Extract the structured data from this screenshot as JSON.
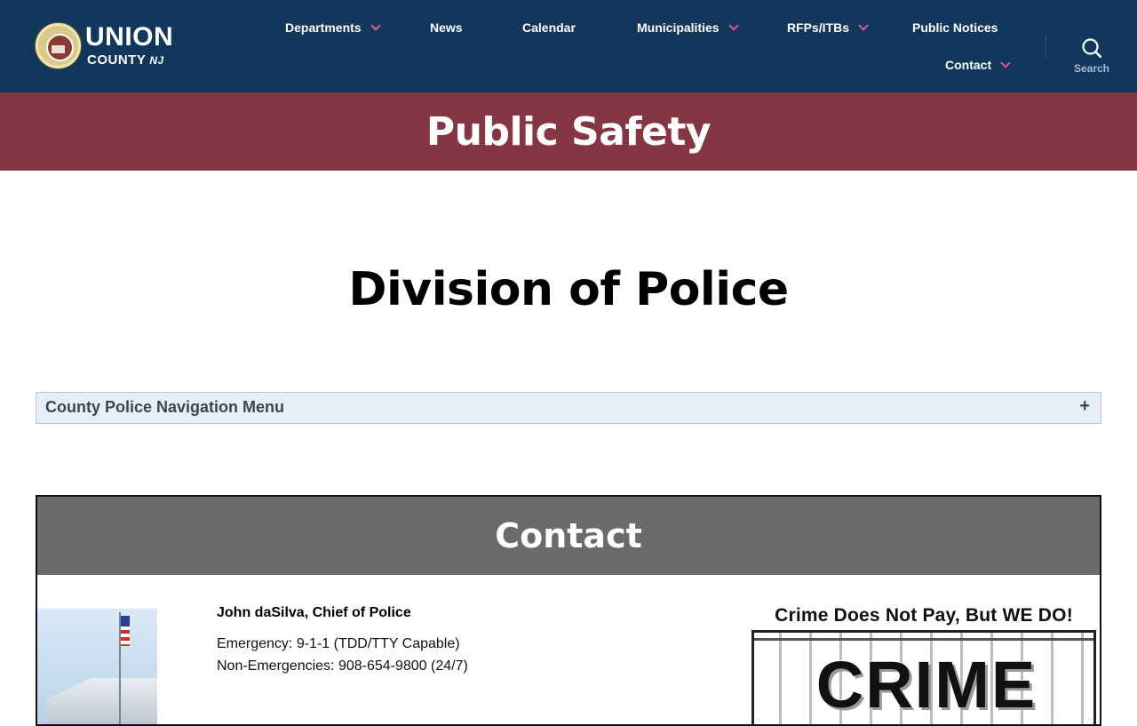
{
  "header": {
    "logo": {
      "line1": "UNION",
      "line2": "COUNTY",
      "line2_suffix": "NJ"
    },
    "nav": [
      {
        "label": "Departments",
        "has_dropdown": true
      },
      {
        "label": "News",
        "has_dropdown": false
      },
      {
        "label": "Calendar",
        "has_dropdown": false
      },
      {
        "label": "Municipalities",
        "has_dropdown": true
      },
      {
        "label": "RFPs/ITBs",
        "has_dropdown": true
      },
      {
        "label": "Public Notices",
        "has_dropdown": false
      },
      {
        "label": "Contact",
        "has_dropdown": true
      }
    ],
    "search": {
      "label": "Search",
      "icon": "search-icon"
    }
  },
  "banner": {
    "title": "Public Safety"
  },
  "page": {
    "title": "Division of Police"
  },
  "accordion": {
    "title": "County Police Navigation Menu",
    "toggle": "+"
  },
  "contact": {
    "heading": "Contact",
    "name": "John daSilva, Chief of Police",
    "emergency": "Emergency: 9-1-1 (TDD/TTY Capable)",
    "non_emergency": "Non-Emergencies: 908-654-9800 (24/7)",
    "graphic_tagline": "Crime Does Not Pay, But WE DO!",
    "graphic_word": "CRIME"
  },
  "colors": {
    "header_bg": "#12375c",
    "banner_bg": "#863643",
    "accent_chevron": "#e05b8a",
    "contact_header_bg": "#6b6b6b",
    "accordion_bg": "#e6eef7"
  }
}
